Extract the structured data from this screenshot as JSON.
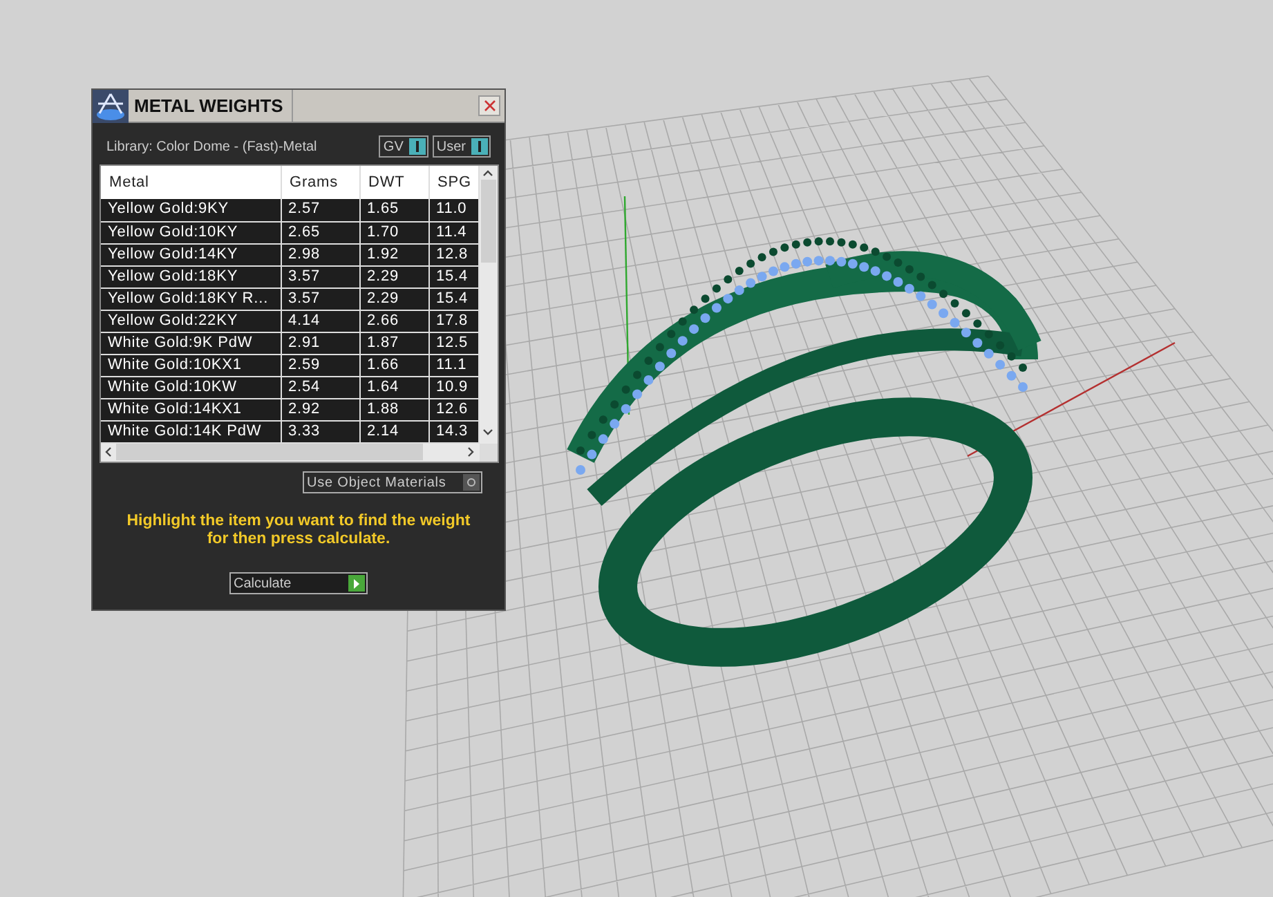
{
  "window": {
    "title": "METAL WEIGHTS"
  },
  "library": "Library: Color Dome - (Fast)-Metal",
  "toggles": [
    {
      "label": "GV",
      "on": true
    },
    {
      "label": "User",
      "on": true
    }
  ],
  "table": {
    "columns": [
      "Metal",
      "Grams",
      "DWT",
      "SPG"
    ],
    "rows": [
      [
        "Yellow Gold:9KY",
        "2.57",
        "1.65",
        "11.0"
      ],
      [
        "Yellow Gold:10KY",
        "2.65",
        "1.70",
        "11.4"
      ],
      [
        "Yellow Gold:14KY",
        "2.98",
        "1.92",
        "12.8"
      ],
      [
        "Yellow Gold:18KY",
        "3.57",
        "2.29",
        "15.4"
      ],
      [
        "Yellow Gold:18KY R...",
        "3.57",
        "2.29",
        "15.4"
      ],
      [
        "Yellow Gold:22KY",
        "4.14",
        "2.66",
        "17.8"
      ],
      [
        "White Gold:9K PdW",
        "2.91",
        "1.87",
        "12.5"
      ],
      [
        "White Gold:10KX1",
        "2.59",
        "1.66",
        "11.1"
      ],
      [
        "White Gold:10KW",
        "2.54",
        "1.64",
        "10.9"
      ],
      [
        "White Gold:14KX1",
        "2.92",
        "1.88",
        "12.6"
      ],
      [
        "White Gold:14K PdW",
        "3.33",
        "2.14",
        "14.3"
      ]
    ]
  },
  "use_object_materials": {
    "label": "Use Object Materials",
    "on": false
  },
  "hint": "Highlight the item you want to find the weight for then press calculate.",
  "calculate_button": "Calculate"
}
